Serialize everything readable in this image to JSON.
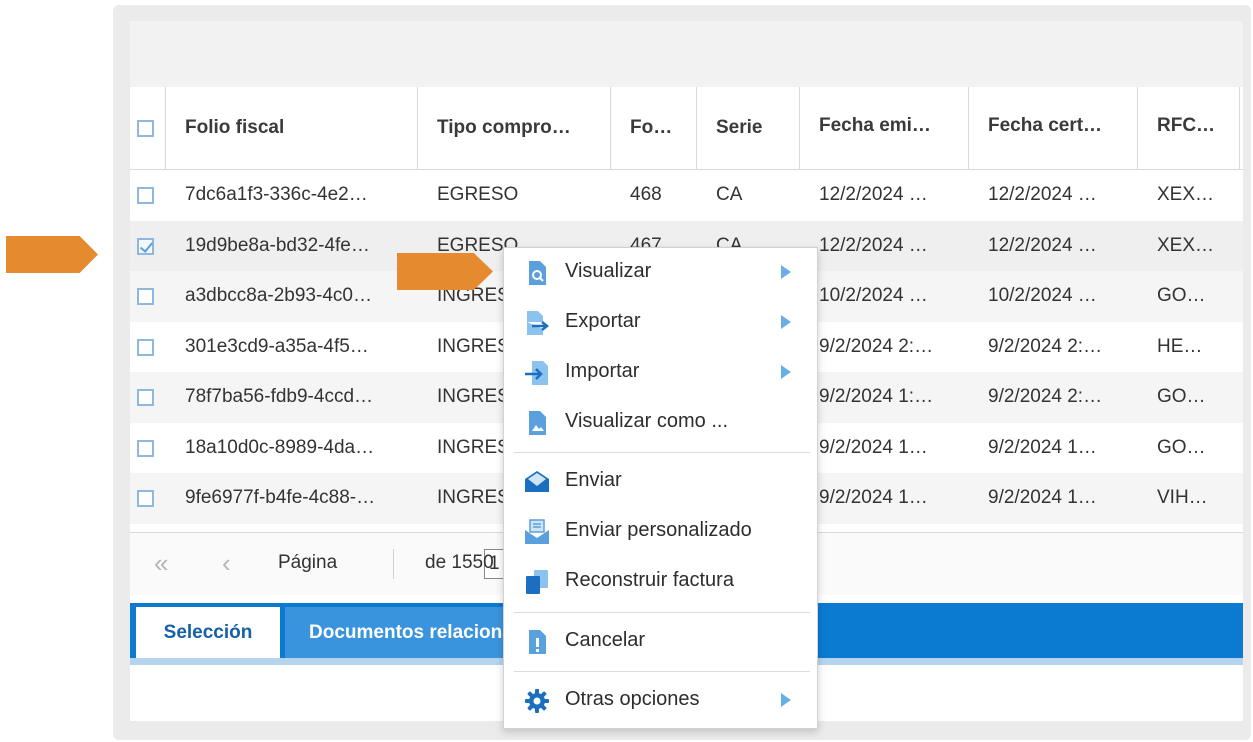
{
  "columns": [
    {
      "label": "Folio fiscal"
    },
    {
      "label": "Tipo compro…"
    },
    {
      "label": "Fo…"
    },
    {
      "label": "Serie"
    },
    {
      "label": "Fecha emi…"
    },
    {
      "label": "Fecha cert…"
    },
    {
      "label": "RFC…"
    }
  ],
  "rows": [
    {
      "folio": "7dc6a1f3-336c-4e2…",
      "tipo": "EGRESO",
      "folio_num": "468",
      "serie": "CA",
      "fecha_emision": "12/2/2024 …",
      "fecha_cert": "12/2/2024 …",
      "rfc": "XEX…",
      "checked": false
    },
    {
      "folio": "19d9be8a-bd32-4fe…",
      "tipo": "EGRESO",
      "folio_num": "467",
      "serie": "CA",
      "fecha_emision": "12/2/2024 …",
      "fecha_cert": "12/2/2024 …",
      "rfc": "XEX…",
      "checked": true
    },
    {
      "folio": "a3dbcc8a-2b93-4c0…",
      "tipo": "INGRESO",
      "folio_num": "",
      "serie": "",
      "fecha_emision": "10/2/2024 …",
      "fecha_cert": "10/2/2024 …",
      "rfc": "GO…",
      "checked": false
    },
    {
      "folio": "301e3cd9-a35a-4f5…",
      "tipo": "INGRESO",
      "folio_num": "",
      "serie": "",
      "fecha_emision": "9/2/2024 2:…",
      "fecha_cert": "9/2/2024 2:…",
      "rfc": "HE…",
      "checked": false
    },
    {
      "folio": "78f7ba56-fdb9-4ccd…",
      "tipo": "INGRESO",
      "folio_num": "",
      "serie": "",
      "fecha_emision": "9/2/2024 1:…",
      "fecha_cert": "9/2/2024 2:…",
      "rfc": "GO…",
      "checked": false
    },
    {
      "folio": "18a10d0c-8989-4da…",
      "tipo": "INGRESO",
      "folio_num": "",
      "serie": "",
      "fecha_emision": "9/2/2024 1…",
      "fecha_cert": "9/2/2024 1…",
      "rfc": "GO…",
      "checked": false
    },
    {
      "folio": "9fe6977f-b4fe-4c88-…",
      "tipo": "INGRESO",
      "folio_num": "",
      "serie": "",
      "fecha_emision": "9/2/2024 1…",
      "fecha_cert": "9/2/2024 1…",
      "rfc": "VIH…",
      "checked": false
    }
  ],
  "pager": {
    "first_icon": "double-chevron-left-icon",
    "prev_icon": "chevron-left-icon",
    "page_label": "Página",
    "page_value": "1",
    "of_label": "de 1550"
  },
  "tabs": {
    "active": "Selección",
    "second": "Documentos relacionados"
  },
  "context_menu": {
    "items": [
      {
        "label": "Visualizar",
        "icon": "search-document-icon",
        "submenu": true
      },
      {
        "label": "Exportar",
        "icon": "export-icon",
        "submenu": true
      },
      {
        "label": "Importar",
        "icon": "import-icon",
        "submenu": true
      },
      {
        "label": "Visualizar como ...",
        "icon": "image-document-icon",
        "submenu": false
      },
      {
        "label": "Enviar",
        "icon": "envelope-icon",
        "submenu": false
      },
      {
        "label": "Enviar personalizado",
        "icon": "envelope-open-icon",
        "submenu": false
      },
      {
        "label": "Reconstruir factura",
        "icon": "copy-document-icon",
        "submenu": false
      },
      {
        "label": "Cancelar",
        "icon": "alert-document-icon",
        "submenu": false
      },
      {
        "label": "Otras opciones",
        "icon": "gear-icon",
        "submenu": true
      }
    ]
  },
  "colors": {
    "accent_blue": "#0a7bd1",
    "annotation_orange": "#e58a2e",
    "icon_blue": "#5aa0dc"
  }
}
